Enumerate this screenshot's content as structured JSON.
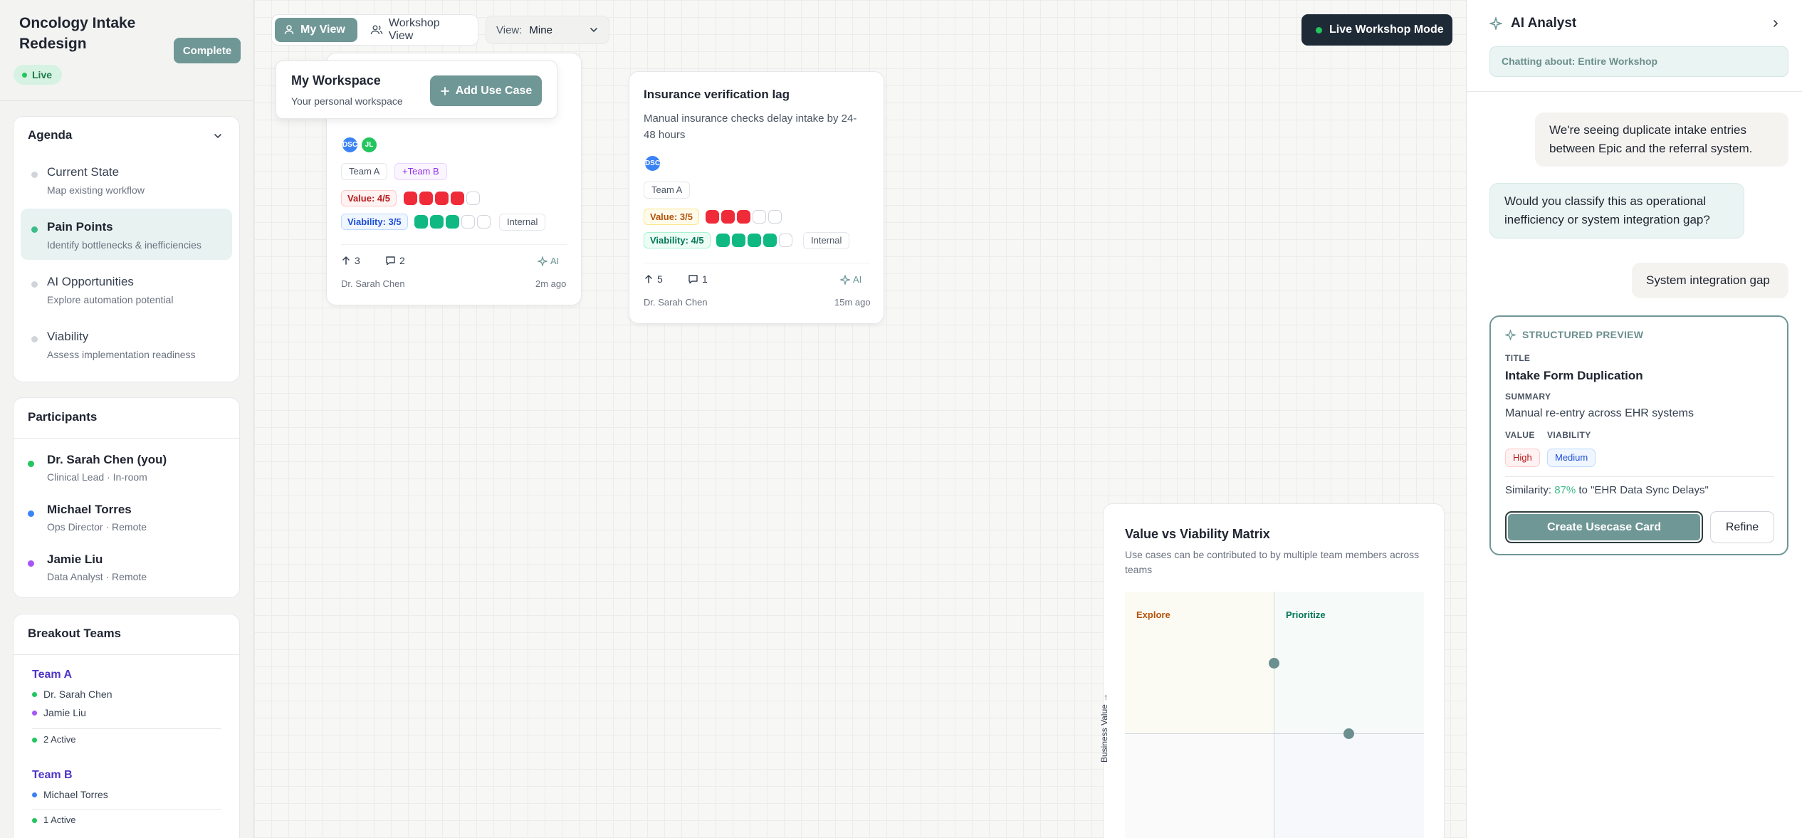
{
  "project": {
    "title": "Oncology Intake Redesign",
    "complete_label": "Complete",
    "status": "Live"
  },
  "agenda": {
    "title": "Agenda",
    "items": [
      {
        "name": "Current State",
        "desc": "Map existing workflow",
        "active": false
      },
      {
        "name": "Pain Points",
        "desc": "Identify bottlenecks & inefficiencies",
        "active": true
      },
      {
        "name": "AI Opportunities",
        "desc": "Explore automation potential",
        "active": false
      },
      {
        "name": "Viability",
        "desc": "Assess implementation readiness",
        "active": false
      }
    ]
  },
  "participants": {
    "title": "Participants",
    "items": [
      {
        "name": "Dr. Sarah Chen (you)",
        "role": "Clinical Lead · In-room",
        "color": "#22c55e"
      },
      {
        "name": "Michael Torres",
        "role": "Ops Director · Remote",
        "color": "#3b82f6"
      },
      {
        "name": "Jamie Liu",
        "role": "Data Analyst · Remote",
        "color": "#a855f7"
      }
    ]
  },
  "teams": {
    "title": "Breakout Teams",
    "items": [
      {
        "name": "Team A",
        "members": [
          {
            "name": "Dr. Sarah Chen",
            "color": "#22c55e"
          },
          {
            "name": "Jamie Liu",
            "color": "#a855f7"
          }
        ],
        "active": "2 Active"
      },
      {
        "name": "Team B",
        "members": [
          {
            "name": "Michael Torres",
            "color": "#3b82f6"
          }
        ],
        "active": "1 Active"
      }
    ]
  },
  "toolbar": {
    "my_view": "My View",
    "workshop_view": "Workshop View",
    "view_label": "View:",
    "view_value": "Mine",
    "live_mode": "Live Workshop Mode"
  },
  "workspace": {
    "title": "My Workspace",
    "subtitle": "Your personal workspace",
    "add_label": "Add Use Case"
  },
  "cards": [
    {
      "avatars": [
        {
          "initials": "DSC",
          "color": "#3b82f6"
        },
        {
          "initials": "JL",
          "color": "#22c55e"
        }
      ],
      "chips": [
        "Team A",
        "+Team B"
      ],
      "value_label": "Value: 4/5",
      "value": 4,
      "viability_label": "Viability: 3/5",
      "viability": 3,
      "scope": "Internal",
      "upvotes": "3",
      "comments": "2",
      "ai": "AI",
      "author": "Dr. Sarah Chen",
      "time": "2m ago"
    },
    {
      "title": "Insurance verification lag",
      "desc": "Manual insurance checks delay intake by 24-48 hours",
      "avatars": [
        {
          "initials": "DSC",
          "color": "#3b82f6"
        }
      ],
      "chips": [
        "Team A"
      ],
      "value_label": "Value: 3/5",
      "value": 3,
      "viability_label": "Viability: 4/5",
      "viability": 4,
      "scope": "Internal",
      "upvotes": "5",
      "comments": "1",
      "ai": "AI",
      "author": "Dr. Sarah Chen",
      "time": "15m ago"
    }
  ],
  "matrix": {
    "title": "Value vs Viability Matrix",
    "subtitle": "Use cases can be contributed to by multiple team members across teams",
    "quadrants": {
      "top_left": "Explore",
      "top_right": "Prioritize"
    },
    "ylabel": "Business Value →"
  },
  "ai_panel": {
    "title": "AI Analyst",
    "context": "Chatting about: Entire Workshop",
    "messages": [
      {
        "role": "user",
        "text": "We're seeing duplicate intake entries between Epic and the referral system."
      },
      {
        "role": "bot",
        "text": "Would you classify this as operational inefficiency or system integration gap?"
      },
      {
        "role": "user",
        "text": "System integration gap"
      }
    ],
    "preview": {
      "heading": "STRUCTURED PREVIEW",
      "title_label": "TITLE",
      "title": "Intake Form Duplication",
      "summary_label": "SUMMARY",
      "summary": "Manual re-entry across EHR systems",
      "value_label": "VALUE",
      "viability_label": "VIABILITY",
      "value": "High",
      "viability": "Medium",
      "similarity_prefix": "Similarity:",
      "similarity_pct": "87%",
      "similarity_suffix": "to \"EHR Data Sync Delays\"",
      "create_label": "Create Usecase Card",
      "refine_label": "Refine"
    }
  }
}
